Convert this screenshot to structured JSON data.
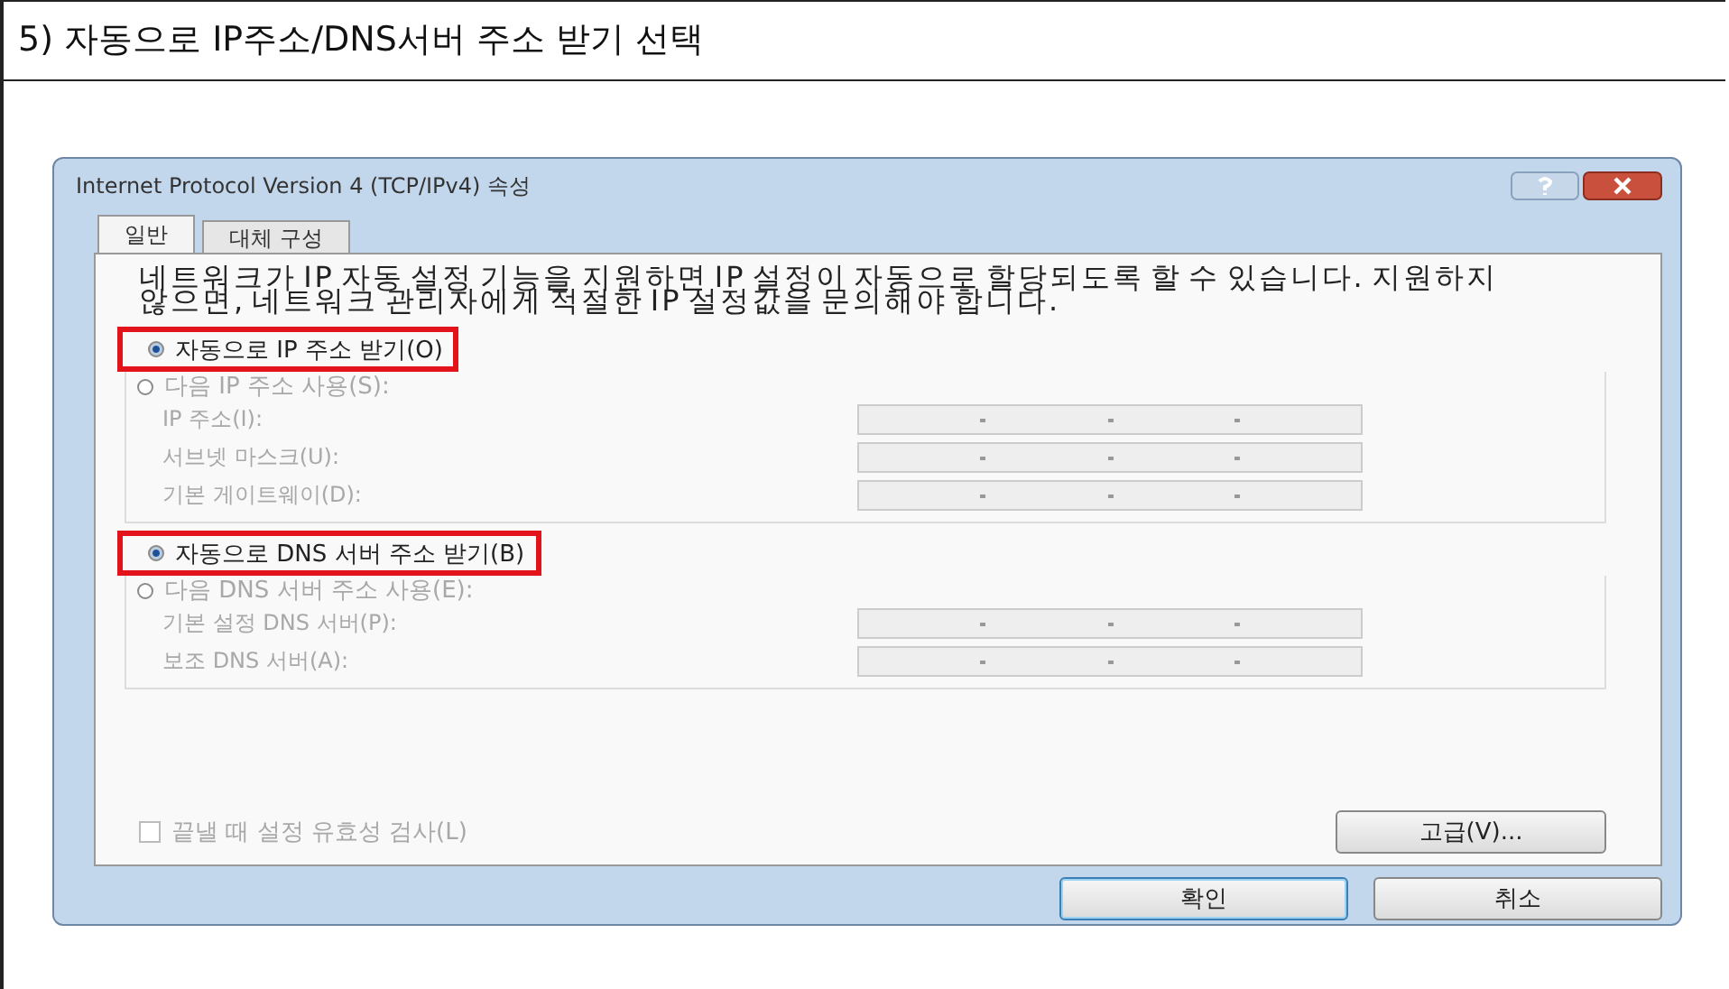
{
  "heading": "5) 자동으로 IP주소/DNS서버 주소 받기 선택",
  "dialog": {
    "title": "Internet Protocol Version 4 (TCP/IPv4) 속성",
    "tabs": [
      {
        "label": "일반",
        "selected": true
      },
      {
        "label": "대체 구성",
        "selected": false
      }
    ],
    "description": "네트워크가 IP 자동 설정 기능을 지원하면 IP 설정이 자동으로 할당되도록 할 수 있습니다. 지원하지 않으면, 네트워크 관리자에게 적절한 IP 설정값을 문의해야 합니다.",
    "sections": [
      {
        "auto": {
          "label": "자동으로 IP 주소 받기(O)",
          "selected": true,
          "highlighted": true
        },
        "manual": {
          "label": "다음 IP 주소 사용(S):",
          "selected": false
        },
        "fields": [
          {
            "label": "IP 주소(I):",
            "disabled": true
          },
          {
            "label": "서브넷 마스크(U):",
            "disabled": true
          },
          {
            "label": "기본 게이트웨이(D):",
            "disabled": true
          }
        ]
      },
      {
        "auto": {
          "label": "자동으로 DNS 서버 주소 받기(B)",
          "selected": true,
          "highlighted": true
        },
        "manual": {
          "label": "다음 DNS 서버 주소 사용(E):",
          "selected": false
        },
        "fields": [
          {
            "label": "기본 설정 DNS 서버(P):",
            "disabled": true
          },
          {
            "label": "보조 DNS 서버(A):",
            "disabled": true
          }
        ]
      }
    ],
    "validate": {
      "label": "끝낼 때 설정 유효성 검사(L)",
      "checked": false,
      "disabled": true
    },
    "advanced_button": "고급(V)...",
    "buttons": [
      "확인",
      "취소"
    ]
  }
}
